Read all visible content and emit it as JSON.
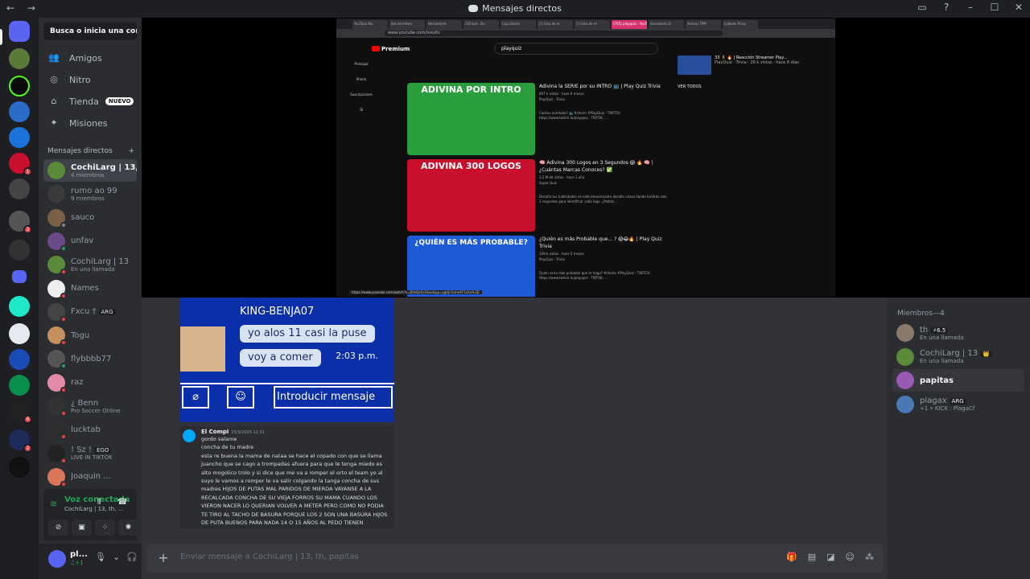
{
  "window": {
    "title": "Mensajes directos",
    "nav": "← →"
  },
  "sidebar": {
    "search": "Busca o inicia una conv...",
    "nav": [
      {
        "label": "Amigos",
        "icon": "friends-icon",
        "glyph": "👥"
      },
      {
        "label": "Nitro",
        "icon": "nitro-icon",
        "glyph": "◎"
      },
      {
        "label": "Tienda",
        "icon": "shop-icon",
        "glyph": "⌂",
        "badge": "NUEVO"
      },
      {
        "label": "Misiones",
        "icon": "quests-icon",
        "glyph": "✦"
      }
    ],
    "dm_header": "Mensajes directos",
    "dm_add": "+",
    "dms": [
      {
        "name": "CochiLarg | 13,...",
        "sub": "4 miembros",
        "color": "#5b8a3a",
        "active": true
      },
      {
        "name": "rumo ao 99",
        "sub": "9 miembros",
        "color": "#3b3b3b"
      },
      {
        "name": "sauco",
        "sub": "",
        "color": "#7a6045",
        "status": "#80848e"
      },
      {
        "name": "unfav",
        "sub": "",
        "color": "#6b4a8a",
        "status": "#23a55a"
      },
      {
        "name": "CochiLarg | 13",
        "sub": "En una llamada",
        "color": "#5b8a3a",
        "status": "#f23f43"
      },
      {
        "name": "Names",
        "sub": "",
        "color": "#eeeeee",
        "status": "#f23f43"
      },
      {
        "name": "Fxcu †",
        "sub": "",
        "tag": "ARG",
        "color": "#444444",
        "status": "#f23f43"
      },
      {
        "name": "Togu",
        "sub": "",
        "color": "#c59060",
        "status": "#f23f43"
      },
      {
        "name": "flybbbb77",
        "sub": "",
        "color": "#555555",
        "status": "#23a55a"
      },
      {
        "name": "raz",
        "sub": "",
        "color": "#e38aa8",
        "status": "#f23f43"
      },
      {
        "name": "¿ Benn",
        "sub": "Pro Soccer Online",
        "color": "#333333",
        "status": "#f23f43"
      },
      {
        "name": "lucktab",
        "sub": "",
        "color": "#2e2e2e",
        "status": "#f23f43"
      },
      {
        "name": "! Sz !",
        "sub": "LIVE IN TIKTOK",
        "tag": "EGO",
        "color": "#222222",
        "status": "#f23f43"
      },
      {
        "name": "Joaquin ...",
        "sub": "",
        "color": "#d9765a",
        "status": "#f23f43"
      }
    ]
  },
  "voice": {
    "title": "Voz conectada",
    "sub": "CochiLarg | 13, th, ..."
  },
  "user": {
    "name": "pl...",
    "sub": "♫+1"
  },
  "stream": {
    "url": "www.youtube.com/results",
    "tabs": [
      "YouTube Mu",
      "Bot de Intern",
      "Herramient",
      "CSFloat - Bu",
      "Caja Diario",
      "(!) lista de m",
      "(!) lista de m",
      "(705) playquiz - YouTu",
      "Servidores D",
      "Activar TPM",
      "Lobbies Priva"
    ],
    "yt_brand": "Premium",
    "query": "playquiz",
    "side_items": [
      "Principal",
      "Shorts",
      "Suscripciones",
      "Tú"
    ],
    "videos": [
      {
        "thumb_text": "ADIVINA POR INTRO",
        "thumb_bg": "#2a9d3c",
        "title": "Adivina la SERIE por su INTRO 📺 | Play Quiz Trivia",
        "meta": "897 k vistas · hace 6 meses",
        "channel": "PlayQuiz - Trivia",
        "desc": "Cositos acertado? 📺 #shorts #PlayQuiz - TWITCH: https://www.twitch.tv/playquiz - TIKTOK: ..."
      },
      {
        "thumb_text": "ADIVINA 300 LOGOS",
        "thumb_bg": "#c8102e",
        "title": "🧠 Adivina 300 Logos en 3 Segundos 😱 🔥 🧠 | ¿Cuántas Marcas Conoces? ✅",
        "meta": "3,3 M de vistas · hace 1 año",
        "channel": "Super Quiz",
        "desc": "Desafía tus habilidades en este emocionante desafío visual donde tendrás solo 3 segundos para identificar cada logo. ¿Podrás ..."
      },
      {
        "thumb_text": "¿QUIÉN ES MÁS PROBABLE?",
        "thumb_bg": "#1e5bd6",
        "title": "¿Quién es más Probable que... ? 😱😂🔥 | Play Quiz Trivia",
        "meta": "339 k vistas · hace 5 meses",
        "channel": "PlayQuiz - Trivia",
        "desc": "Quien seria más probable que te haga? #shorts #PlayQuiz - TWITCH: https://www.twitch.tv/playquiz - TIKTOK: ..."
      }
    ],
    "right_title": "33 🧍 🔥 | Reacción Streamer Play...",
    "right_meta": "PlayQuiz - Trivia · 26 k vistas · hace 8 días",
    "ver_todos": "VER TODOS",
    "status_link": "https://www.youtube.com/watch?v=8VeQeXxOkxo&pp=ygUJcGxheXF1aXo%3D"
  },
  "chat": {
    "embed": {
      "header": "KING-BENJA07",
      "bubble1": "yo alos 11 casi la puse",
      "bubble2": "voy a comer",
      "time": "2:03 p.m.",
      "input": "Introducir mensaje"
    },
    "message": {
      "author": "El Compi",
      "time": "25/9/2025 11:31",
      "lines": [
        "gordo salame",
        "concha de tu madre",
        "esta re buena la mama de nataa se hace el copado con que se llama juancho que se cago a trompadas afuera para que le tenga miedo es alto mogolico trolo y si dice que me va a romper el orto el team yo al suyo le vamos a romper le va salir colgando la tanga concha de sus madres HIJOS DE PUTAS MAL PARIDOS DE MIERDA VAYANSE A LA RECALCADA CONCHA DE SU VIEJA FORROS SU MAMA CUANDO LOS VIERON NACER LO QUERIAN VOLVER A METER PERO COMO NO PODIA TE TIRO AL TACHO DE BASURA PORQUE LOS 2 SON UNA BASURA HIJOS DE PUTA BUENOS PARA NADA 14 O 15 AÑOS AL PEDO TIENEN"
      ]
    },
    "composer_placeholder": "Enviar mensaje a CochiLarg | 13, th, papitas"
  },
  "members": {
    "header": "Miembros—4",
    "list": [
      {
        "name": "th",
        "tag": "⚡6.5",
        "sub": "En una llamada",
        "color": "#8a7a6a"
      },
      {
        "name": "CochiLarg | 13",
        "tag": "👑",
        "sub": "En una llamada",
        "color": "#5b8a3a"
      },
      {
        "name": "papitas",
        "tag": "",
        "sub": "",
        "color": "#9b59b6",
        "selected": true
      },
      {
        "name": "plagax",
        "tag": "ARG",
        "sub": "+1 • KICK : PlagaCf",
        "color": "#4a78b5"
      }
    ]
  },
  "colors": {
    "accent": "#5865f2",
    "online": "#23a55a",
    "dnd": "#f23f43"
  }
}
